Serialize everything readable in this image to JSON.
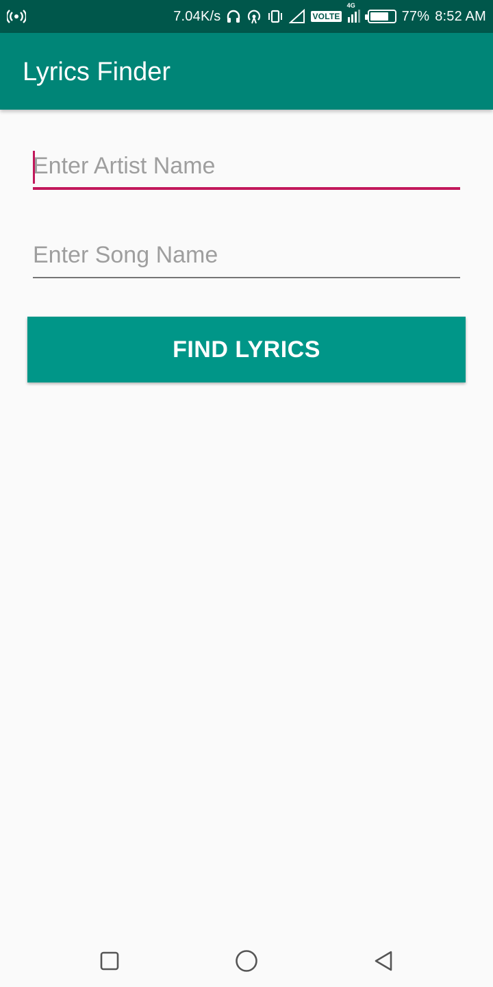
{
  "status_bar": {
    "net_speed": "7.04K/s",
    "network_badge": "VOLTE",
    "network_type": "4G",
    "battery_percent": "77%",
    "battery_level": 0.77,
    "time": "8:52 AM",
    "icons": [
      "hotspot-icon",
      "headphones-icon",
      "wifi-hotspot-icon",
      "vibrate-icon",
      "signal-icon",
      "signal-bars-icon",
      "battery-icon"
    ]
  },
  "app_bar": {
    "title": "Lyrics Finder"
  },
  "form": {
    "artist_placeholder": "Enter Artist Name",
    "song_placeholder": "Enter Song Name",
    "find_button_label": "FIND LYRICS"
  },
  "colors": {
    "status_bar": "#00574b",
    "app_bar": "#008577",
    "accent": "#c2185b",
    "button": "#009688"
  },
  "nav_bar": {
    "icons": [
      "recents-icon",
      "home-icon",
      "back-icon"
    ]
  }
}
